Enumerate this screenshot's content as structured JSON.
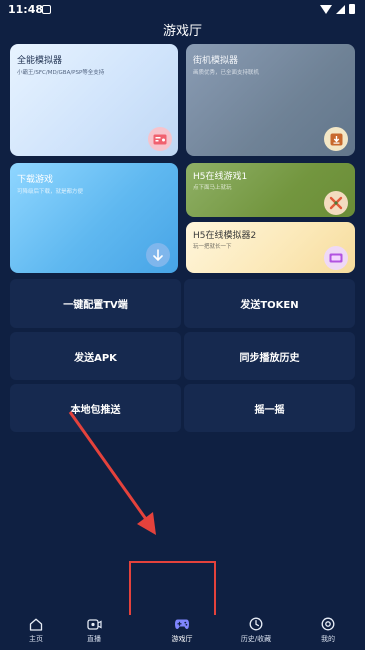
{
  "status_bar": {
    "time": "11:48"
  },
  "page_title": "游戏厅",
  "cards": {
    "all_emulator": {
      "title": "全能模拟器",
      "subtitle": "小霸王/SFC/MD/GBA/PSP等全支持"
    },
    "arcade": {
      "title": "街机模拟器",
      "subtitle": "画质优秀，已全面支持联机"
    },
    "download": {
      "title": "下载游戏",
      "subtitle": "可降级后下载，就是都方便"
    },
    "h5_game": {
      "title": "H5在线游戏1",
      "subtitle": "点下面马上就玩"
    },
    "h5_emulator": {
      "title": "H5在线模拟器2",
      "subtitle": "玩一把就长一下"
    }
  },
  "actions": {
    "config_tv": "一键配置TV端",
    "send_token": "发送TOKEN",
    "send_apk": "发送APK",
    "sync_history": "同步播放历史",
    "local_push": "本地包推送",
    "shake": "摇一摇"
  },
  "nav": {
    "home": "主页",
    "live": "直播",
    "arcade": "游戏厅",
    "history": "历史/收藏",
    "mine": "我的"
  },
  "colors": {
    "background": "#0f2042",
    "button": "#16294f",
    "active_tab": "#7f86ff",
    "annotation": "#e4423c"
  },
  "icons": {
    "all_emulator": "game-card-icon",
    "arcade": "download-box-icon",
    "download": "arrow-down-icon",
    "h5_game": "crossed-swords-icon",
    "h5_emulator": "tv-icon"
  }
}
